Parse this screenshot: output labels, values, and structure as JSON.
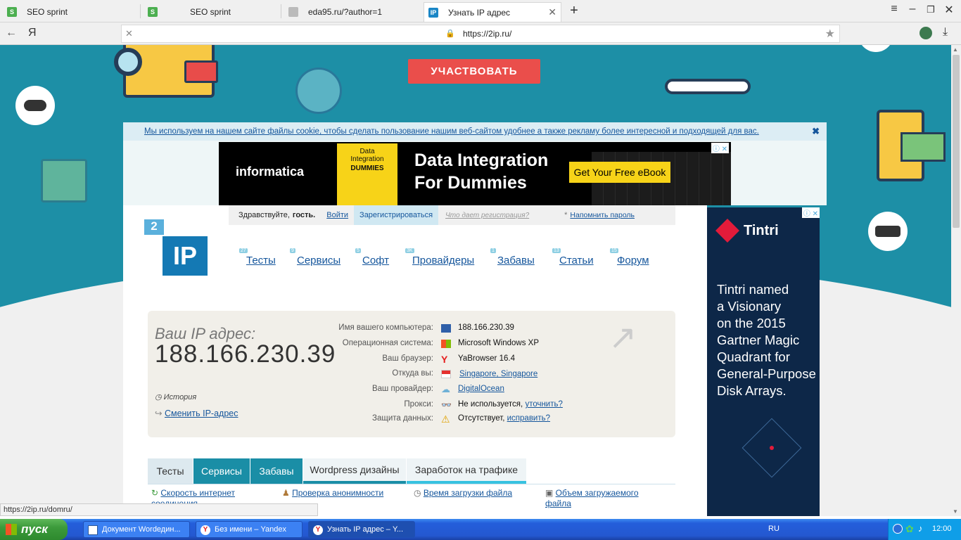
{
  "browser": {
    "tabs": [
      {
        "title": "SEO sprint",
        "favicon": "seosprint-icon",
        "color": "#4caf50"
      },
      {
        "title": "SEO sprint",
        "favicon": "seosprint-icon",
        "color": "#4caf50"
      },
      {
        "title": "eda95.ru/?author=1",
        "favicon": "page-icon",
        "color": "#999999"
      },
      {
        "title": "Узнать IP адрес",
        "favicon": "2ip-icon",
        "color": "#1a86c6"
      }
    ],
    "yandex_letter": "Я",
    "url": "https://2ip.ru/"
  },
  "hero": {
    "cta_label": "УЧАСТВОВАТЬ",
    "accent": "#1d8fa6",
    "cta_color": "#ea4e4b"
  },
  "cookie_notice": "Мы используем на нашем сайте файлы cookie, чтобы сделать пользование нашим веб-сайтом удобнее а также рекламу более интересной и подходящей для вас.",
  "ad_top": {
    "brand": "informatica",
    "book_line1": "Data",
    "book_line2": "Integration",
    "book_line3": "DUMMIES",
    "headline1": "Data Integration",
    "headline2": "For Dummies",
    "cta": "Get Your Free eBook"
  },
  "login": {
    "greeting": "Здравствуйте,",
    "guest": "гость.",
    "login_link": "Войти",
    "register": "Зарегистрироваться",
    "what_gives": "Что дает регистрация?",
    "remind": "Напомнить пароль"
  },
  "logo": {
    "num": "2",
    "text": "IP"
  },
  "nav": [
    {
      "label": "Тесты",
      "count": "27"
    },
    {
      "label": "Сервисы",
      "count": "9"
    },
    {
      "label": "Софт",
      "count": "5"
    },
    {
      "label": "Провайдеры",
      "count": "3K"
    },
    {
      "label": "Забавы",
      "count": "1"
    },
    {
      "label": "Статьи",
      "count": "13"
    },
    {
      "label": "Форум",
      "count": "15"
    }
  ],
  "ip": {
    "title": "Ваш IP адрес:",
    "address": "188.166.230.39",
    "history": "История",
    "change": "Сменить IP-адрес",
    "rows": [
      {
        "label": "Имя вашего компьютера:",
        "value": "188.166.230.39",
        "link": ""
      },
      {
        "label": "Операционная система:",
        "value": "Microsoft Windows XP",
        "link": ""
      },
      {
        "label": "Ваш браузер:",
        "value": "YaBrowser 16.4",
        "link": ""
      },
      {
        "label": "Откуда вы:",
        "value": "",
        "link": "Singapore, Singapore"
      },
      {
        "label": "Ваш провайдер:",
        "value": "",
        "link": "DigitalOcean"
      },
      {
        "label": "Прокси:",
        "value": "Не используется,",
        "link": "уточнить?"
      },
      {
        "label": "Защита данных:",
        "value": "Отсутствует,",
        "link": "исправить?"
      }
    ]
  },
  "service_tabs": [
    "Тесты",
    "Сервисы",
    "Забавы",
    "Wordpress дизайны",
    "Заработок на трафике"
  ],
  "services": [
    {
      "label": "Скорость интернет соединения"
    },
    {
      "label": "Проверка анонимности"
    },
    {
      "label": "Время загрузки файла"
    },
    {
      "label": "Объем загружаемого файла"
    }
  ],
  "ad_right": {
    "brand": "Tintri",
    "text1": "Tintri named",
    "text2": "a Visionary",
    "text3": "on the 2015",
    "text4": "Gartner Magic",
    "text5": "Quadrant for",
    "text6": "General-Purpose",
    "text7": "Disk Arrays."
  },
  "status_url": "https://2ip.ru/domru/",
  "taskbar": {
    "start": "пуск",
    "tasks": [
      "Документ Wordедин...",
      "Без имени – Yandex",
      "Узнать IP адрес – Y..."
    ],
    "lang": "RU",
    "time": "12:00"
  }
}
